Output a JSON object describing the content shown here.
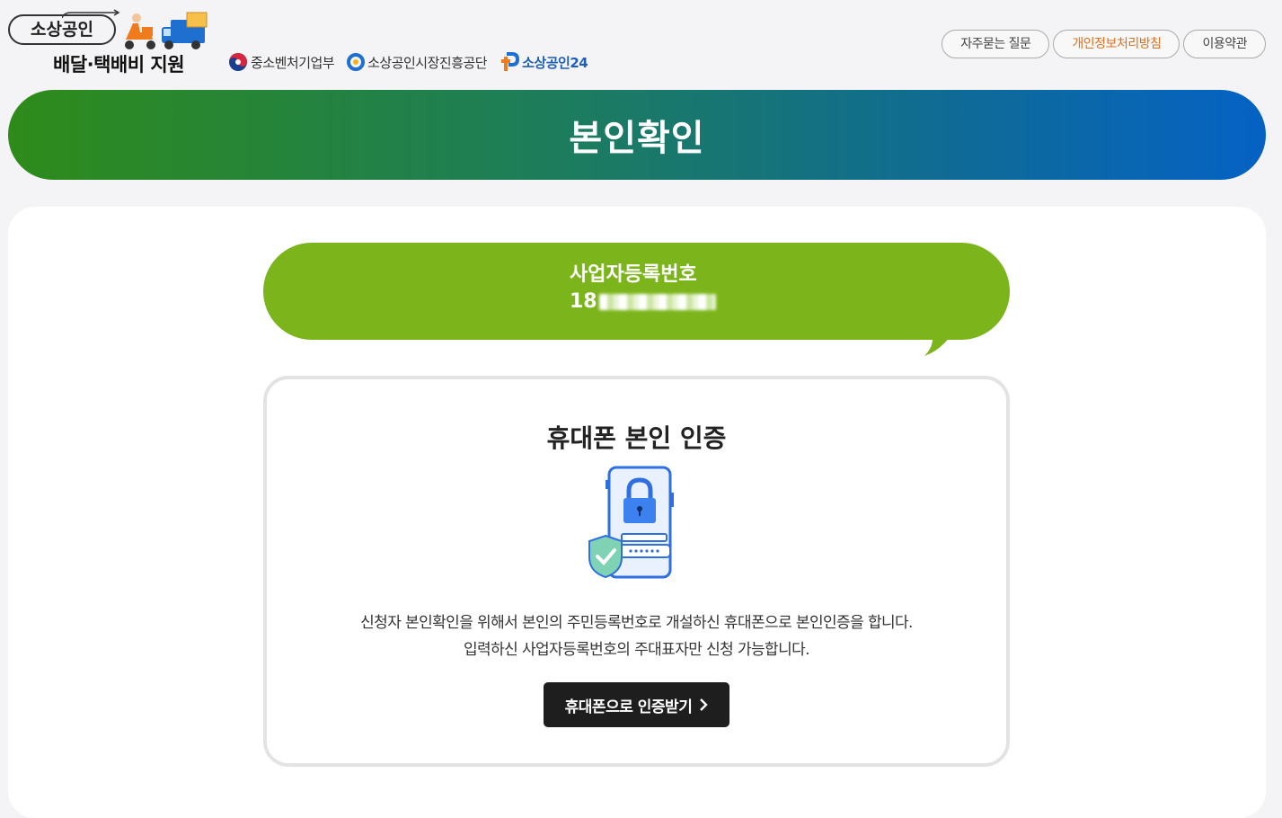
{
  "header": {
    "logo_line1": "소상공인",
    "logo_line2": "배달·택배비 지원",
    "partners": [
      "중소벤처기업부",
      "소상공인시장진흥공단",
      "소상공인24"
    ],
    "links": [
      {
        "label": "자주묻는 질문"
      },
      {
        "label": "개인정보처리방침",
        "color": "#e0701f"
      },
      {
        "label": "이용약관"
      }
    ]
  },
  "hero": {
    "title": "본인확인"
  },
  "business": {
    "label": "사업자등록번호",
    "number_visible": "18"
  },
  "auth": {
    "title": "휴대폰 본인 인증",
    "desc_line1": "신청자 본인확인을 위해서 본인의 주민등록번호로 개설하신 휴대폰으로 본인인증을 합니다.",
    "desc_line2": "입력하신 사업자등록번호의 주대표자만 신청 가능합니다.",
    "button_label": "휴대폰으로 인증받기"
  },
  "colors": {
    "hero_start": "#2e8b1a",
    "hero_end": "#0562c4",
    "bubble": "#7cb51b",
    "button": "#1e1e1e"
  }
}
